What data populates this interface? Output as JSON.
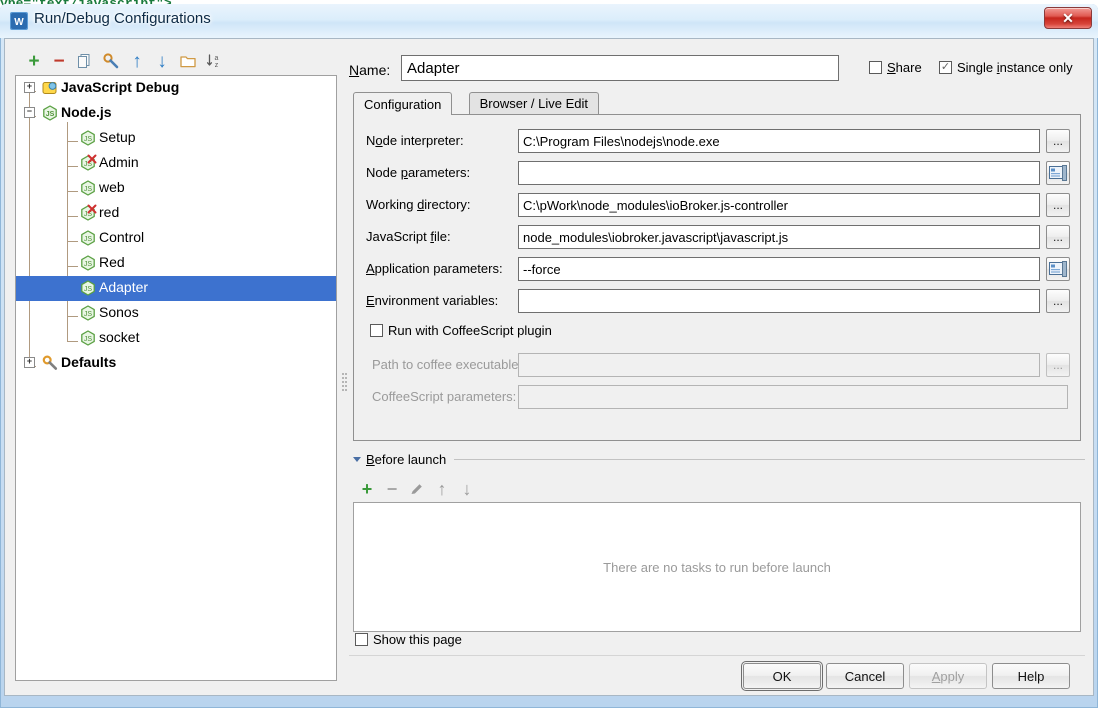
{
  "background": {
    "code_sliver": "ype=\"text/javascript\">"
  },
  "window": {
    "title": "Run/Debug Configurations",
    "app_icon": "webstorm-logo-icon",
    "close_label": "✕"
  },
  "tree_toolbar": {
    "buttons": [
      {
        "name": "add-configuration-button",
        "glyph": "+",
        "color": "#3a9a3a",
        "title": "Add New Configuration"
      },
      {
        "name": "remove-configuration-button",
        "glyph": "−",
        "color": "#c0392b",
        "title": "Remove Configuration"
      },
      {
        "name": "copy-configuration-button",
        "glyph": "copy-icon",
        "color": "#6e8fa8",
        "title": "Copy Configuration"
      },
      {
        "name": "edit-defaults-button",
        "glyph": "wrench-icon",
        "color": "#4a7fb5",
        "title": "Edit defaults"
      },
      {
        "name": "move-up-button",
        "glyph": "↑",
        "color": "#2d7cc4",
        "title": "Move Up"
      },
      {
        "name": "move-down-button",
        "glyph": "↓",
        "color": "#2d7cc4",
        "title": "Move Down"
      },
      {
        "name": "create-folder-button",
        "glyph": "folder-icon",
        "color": "#d09a44",
        "title": "Create New Folder"
      },
      {
        "name": "sort-configurations-button",
        "glyph": "sort-az-icon",
        "color": "#5a5a5a",
        "title": "Sort Configurations"
      }
    ]
  },
  "tree": {
    "nodes": [
      {
        "label": "JavaScript Debug",
        "icon": "javascript-debug-icon",
        "level": 0,
        "bold": true,
        "expander": "+",
        "selected": false,
        "error": false
      },
      {
        "label": "Node.js",
        "icon": "nodejs-icon",
        "level": 0,
        "bold": true,
        "expander": "−",
        "selected": false,
        "error": false
      },
      {
        "label": "Setup",
        "icon": "nodejs-icon",
        "level": 1,
        "bold": false,
        "expander": "",
        "selected": false,
        "error": false
      },
      {
        "label": "Admin",
        "icon": "nodejs-icon",
        "level": 1,
        "bold": false,
        "expander": "",
        "selected": false,
        "error": true
      },
      {
        "label": "web",
        "icon": "nodejs-icon",
        "level": 1,
        "bold": false,
        "expander": "",
        "selected": false,
        "error": false
      },
      {
        "label": "red",
        "icon": "nodejs-icon",
        "level": 1,
        "bold": false,
        "expander": "",
        "selected": false,
        "error": true
      },
      {
        "label": "Control",
        "icon": "nodejs-icon",
        "level": 1,
        "bold": false,
        "expander": "",
        "selected": false,
        "error": false
      },
      {
        "label": "Red",
        "icon": "nodejs-icon",
        "level": 1,
        "bold": false,
        "expander": "",
        "selected": false,
        "error": false
      },
      {
        "label": "Adapter",
        "icon": "nodejs-icon",
        "level": 1,
        "bold": false,
        "expander": "",
        "selected": true,
        "error": false
      },
      {
        "label": "Sonos",
        "icon": "nodejs-icon",
        "level": 1,
        "bold": false,
        "expander": "",
        "selected": false,
        "error": false
      },
      {
        "label": "socket",
        "icon": "nodejs-icon",
        "level": 1,
        "bold": false,
        "expander": "",
        "selected": false,
        "error": false
      },
      {
        "label": "Defaults",
        "icon": "defaults-wrench-icon",
        "level": 0,
        "bold": true,
        "expander": "+",
        "selected": false,
        "error": false
      }
    ],
    "selection_color": "#3d72cf"
  },
  "header": {
    "name_label": "Name:",
    "name_mnemonic": "N",
    "name_value": "Adapter",
    "share_label": "Share",
    "share_checked": false,
    "single_instance_label": "Single instance only",
    "single_instance_checked": true
  },
  "tabs": [
    {
      "label": "Configuration",
      "active": true
    },
    {
      "label": "Browser / Live Edit",
      "active": false
    }
  ],
  "fields": [
    {
      "label": "Node interpreter:",
      "value": "C:\\Program Files\\nodejs\\node.exe",
      "button": "...",
      "button_kind": "browse",
      "disabled": false
    },
    {
      "label": "Node parameters:",
      "value": "",
      "button": "expand-editor-icon",
      "button_kind": "expand",
      "disabled": false
    },
    {
      "label": "Working directory:",
      "value": "C:\\pWork\\node_modules\\ioBroker.js-controller",
      "button": "...",
      "button_kind": "browse",
      "disabled": false
    },
    {
      "label": "JavaScript file:",
      "value": "node_modules\\iobroker.javascript\\javascript.js",
      "button": "...",
      "button_kind": "browse",
      "disabled": false
    },
    {
      "label": "Application parameters:",
      "value": "--force",
      "button": "expand-editor-icon",
      "button_kind": "expand",
      "disabled": false
    },
    {
      "label": "Environment variables:",
      "value": "",
      "button": "...",
      "button_kind": "browse",
      "disabled": false
    }
  ],
  "coffee": {
    "checkbox_label": "Run with CoffeeScript plugin",
    "checked": false,
    "path_label": "Path to coffee executable:",
    "path_value": "",
    "path_button": "...",
    "params_label": "CoffeeScript parameters:",
    "params_value": ""
  },
  "before_launch": {
    "title": "Before launch",
    "expanded": true,
    "toolbar": [
      {
        "name": "add-task-button",
        "glyph": "+",
        "color": "#3a9a3a",
        "enabled": true
      },
      {
        "name": "remove-task-button",
        "glyph": "−",
        "color": "#a8a8a8",
        "enabled": false
      },
      {
        "name": "edit-task-button",
        "glyph": "pencil-icon",
        "color": "#9a9a9a",
        "enabled": false
      },
      {
        "name": "move-task-up-button",
        "glyph": "↑",
        "color": "#9a9a9a",
        "enabled": false
      },
      {
        "name": "move-task-down-button",
        "glyph": "↓",
        "color": "#9a9a9a",
        "enabled": false
      }
    ],
    "empty_text": "There are no tasks to run before launch",
    "show_page_label": "Show this page",
    "show_page_checked": false
  },
  "dialog_buttons": [
    {
      "label": "OK",
      "default": true,
      "disabled": false
    },
    {
      "label": "Cancel",
      "default": false,
      "disabled": false
    },
    {
      "label": "Apply",
      "default": false,
      "disabled": true
    },
    {
      "label": "Help",
      "default": false,
      "disabled": false
    }
  ]
}
